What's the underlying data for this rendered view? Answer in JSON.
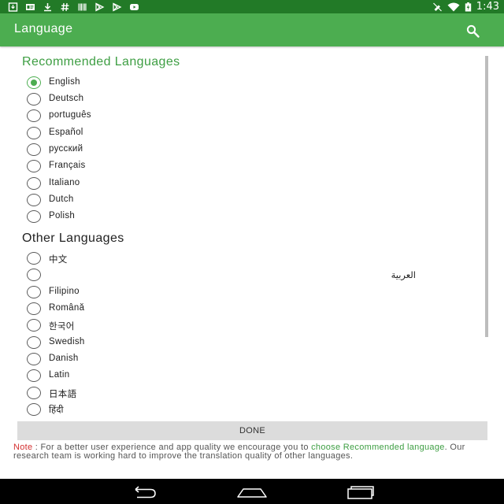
{
  "status_bar": {
    "time": "1:43",
    "left_icons": [
      "download-box-icon",
      "message-icon",
      "download-icon",
      "hashtag-icon",
      "barcode-icon",
      "play-store-icon",
      "play-store-icon",
      "youtube-icon"
    ],
    "right_icons": [
      "mute-icon",
      "wifi-icon",
      "battery-charging-icon"
    ]
  },
  "app_bar": {
    "title": "Language",
    "search_icon": "search-icon"
  },
  "recommended": {
    "header": "Recommended Languages",
    "items": [
      {
        "label": "English",
        "checked": true
      },
      {
        "label": "Deutsch",
        "checked": false
      },
      {
        "label": "português",
        "checked": false
      },
      {
        "label": "Español",
        "checked": false
      },
      {
        "label": "русский",
        "checked": false
      },
      {
        "label": "Français",
        "checked": false
      },
      {
        "label": "Italiano",
        "checked": false
      },
      {
        "label": "Dutch",
        "checked": false
      },
      {
        "label": "Polish",
        "checked": false
      }
    ]
  },
  "other": {
    "header": "Other Languages",
    "items": [
      {
        "label": "中文",
        "checked": false
      },
      {
        "label": "العربية",
        "checked": false
      },
      {
        "label": "Filipino",
        "checked": false
      },
      {
        "label": "Română",
        "checked": false
      },
      {
        "label": "한국어",
        "checked": false
      },
      {
        "label": "Swedish",
        "checked": false
      },
      {
        "label": "Danish",
        "checked": false
      },
      {
        "label": "Latin",
        "checked": false
      },
      {
        "label": "日本語",
        "checked": false
      },
      {
        "label": "हिंदी",
        "checked": false
      }
    ]
  },
  "done_button": {
    "label": "DONE"
  },
  "note": {
    "label": "Note",
    "text_1": " : For a better user experience and app quality we encourage you to ",
    "link": "choose Recommended language",
    "text_2": ". Our research team is working hard to improve the translation quality of other languages."
  },
  "nav_bar": {
    "back_icon": "back-icon",
    "home_icon": "home-icon",
    "recents_icon": "recents-icon"
  },
  "colors": {
    "status_bar": "#227a27",
    "app_bar": "#4cad50",
    "accent": "#4cad50",
    "recommended_header": "#3e9e43",
    "note_label": "#d32f2f",
    "done_button_bg": "#dcdcdc",
    "nav_bar": "#000000"
  }
}
